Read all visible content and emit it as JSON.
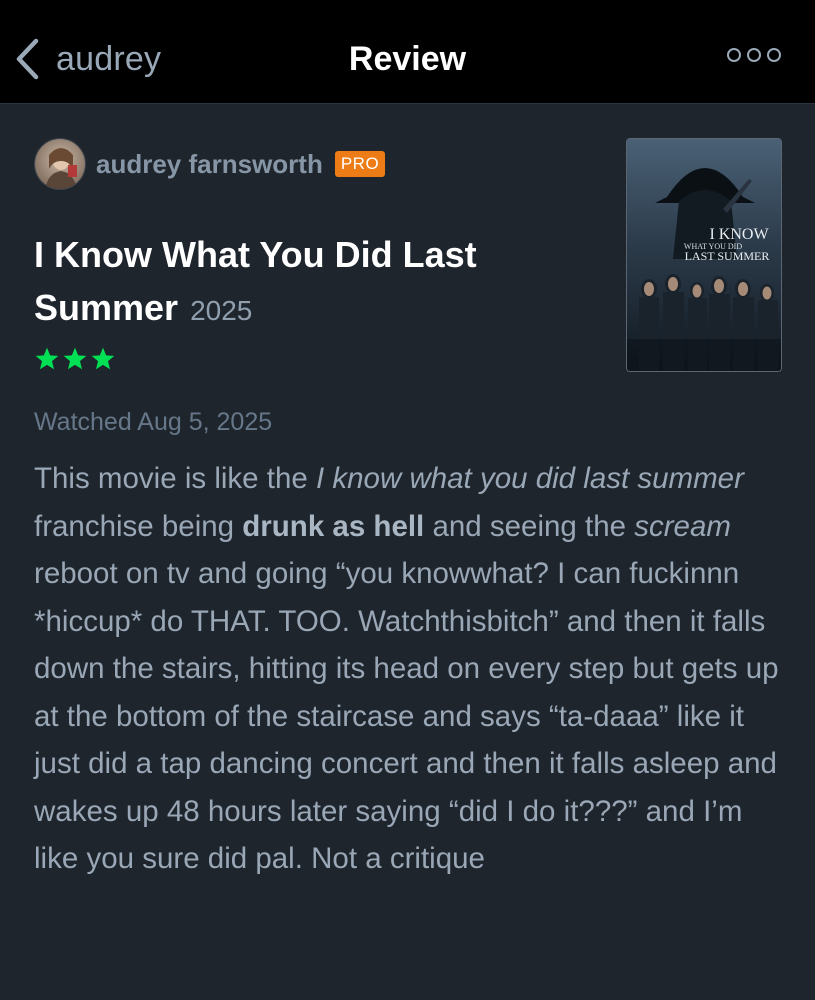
{
  "header": {
    "back_label": "audrey",
    "title": "Review"
  },
  "reviewer": {
    "name": "audrey farnsworth",
    "badge": "PRO"
  },
  "film": {
    "title": "I Know What You Did Last Summer",
    "year": "2025",
    "rating_stars": 3,
    "poster_text": {
      "line1": "I KNOW",
      "line2": "WHAT YOU DID",
      "line3": "LAST SUMMER"
    }
  },
  "watched": "Watched Aug 5, 2025",
  "review": {
    "p1": "This movie is like the ",
    "i1": "I know what you did last summer",
    "p2": " franchise being ",
    "b1": "drunk as hell",
    "p3": " and seeing the ",
    "i2": "scream",
    "p4": " reboot on tv and going “you knowwhat? I can fuckinnn *hiccup* do THAT. TOO. Watchthisbitch” and then it falls down the stairs, hitting its head on every step but gets up at the bottom of the staircase and says “ta-daaa” like it just did a tap dancing concert and then it falls asleep and wakes up 48 hours later saying “did I do it???” and I’m like you sure did pal. Not a critique"
  },
  "colors": {
    "background": "#1f252c",
    "header_bg": "#000000",
    "star_green": "#00e054",
    "pro_orange": "#ee7c16"
  },
  "icons": {
    "back": "chevron-left-icon",
    "more": "more-options-icon",
    "star": "star-icon"
  }
}
